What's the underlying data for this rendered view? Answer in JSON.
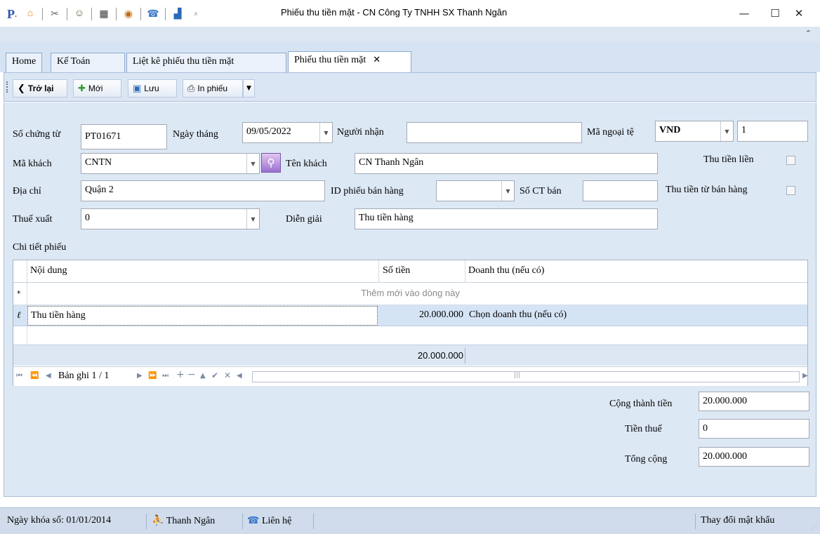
{
  "window": {
    "title": "Phiếu thu tiền mặt - CN Công Ty TNHH SX Thanh Ngân",
    "quick_access_icons": [
      "app-logo-icon",
      "home-icon",
      "tools-icon",
      "users-icon",
      "film-icon",
      "eye-icon",
      "phone-icon",
      "grid-icon"
    ],
    "controls": {
      "minimize": "—",
      "maximize": "☐",
      "close": "✕"
    }
  },
  "ribbon": {
    "collapse": "⌃"
  },
  "tabs": [
    {
      "label": "Home"
    },
    {
      "label": "Kế Toán"
    },
    {
      "label": "Liệt kê phiếu thu tiền mặt"
    },
    {
      "label": "Phiếu thu tiền mặt",
      "active": true,
      "close": "✕"
    }
  ],
  "toolbar": {
    "back": "Trở lại",
    "new": "Mới",
    "save": "Lưu",
    "print": "In phiếu"
  },
  "form": {
    "so_chung_tu": {
      "label": "Số chứng từ",
      "value": "PT01671"
    },
    "ngay_thang": {
      "label": "Ngày tháng",
      "value": "09/05/2022"
    },
    "nguoi_nhan": {
      "label": "Người nhận",
      "value": ""
    },
    "ma_ngoai_te": {
      "label": "Mã ngoại tệ",
      "value": "VND",
      "rate": "1"
    },
    "ma_khach": {
      "label": "Mã khách",
      "value": "CNTN"
    },
    "ten_khach": {
      "label": "Tên khách",
      "value": "CN Thanh Ngân"
    },
    "thu_tien_lien": {
      "label": "Thu tiền liền",
      "checked": false
    },
    "dia_chi": {
      "label": "Địa chỉ",
      "value": "Quận 2"
    },
    "id_phieu_ban_hang": {
      "label": "ID phiếu bán hàng",
      "value": ""
    },
    "so_ct_ban": {
      "label": "Số CT bán",
      "value": ""
    },
    "thu_tien_tu_ban_hang": {
      "label": "Thu tiền từ bán hàng",
      "checked": false
    },
    "thue_xuat": {
      "label": "Thuế xuất",
      "value": "0"
    },
    "dien_giai": {
      "label": "Diễn giải",
      "value": "Thu tiền hàng"
    }
  },
  "details": {
    "section_label": "Chi tiết phiếu",
    "columns": [
      "Nội dung",
      "Số tiền",
      "Doanh thu (nếu có)"
    ],
    "new_row_marker": "*",
    "new_row_text": "Thêm mới vào dòng này",
    "edit_marker": "ℓ",
    "rows": [
      {
        "noi_dung": "Thu tiền hàng",
        "so_tien": "20.000.000",
        "doanh_thu": "Chọn doanh thu (nếu có)"
      }
    ],
    "footer_total": "20.000.000",
    "navigator": {
      "record": "Bản ghi 1 / 1"
    }
  },
  "totals": {
    "cong_thanh_tien": {
      "label": "Cộng thành tiền",
      "value": "20.000.000"
    },
    "tien_thue": {
      "label": "Tiền thuế",
      "value": "0"
    },
    "tong_cong": {
      "label": "Tổng cộng",
      "value": "20.000.000"
    }
  },
  "statusbar": {
    "lock_date": "Ngày khóa số: 01/01/2014",
    "user": "Thanh Ngân",
    "contact": "Liên hệ",
    "change_password": "Thay đổi mật khẩu"
  }
}
